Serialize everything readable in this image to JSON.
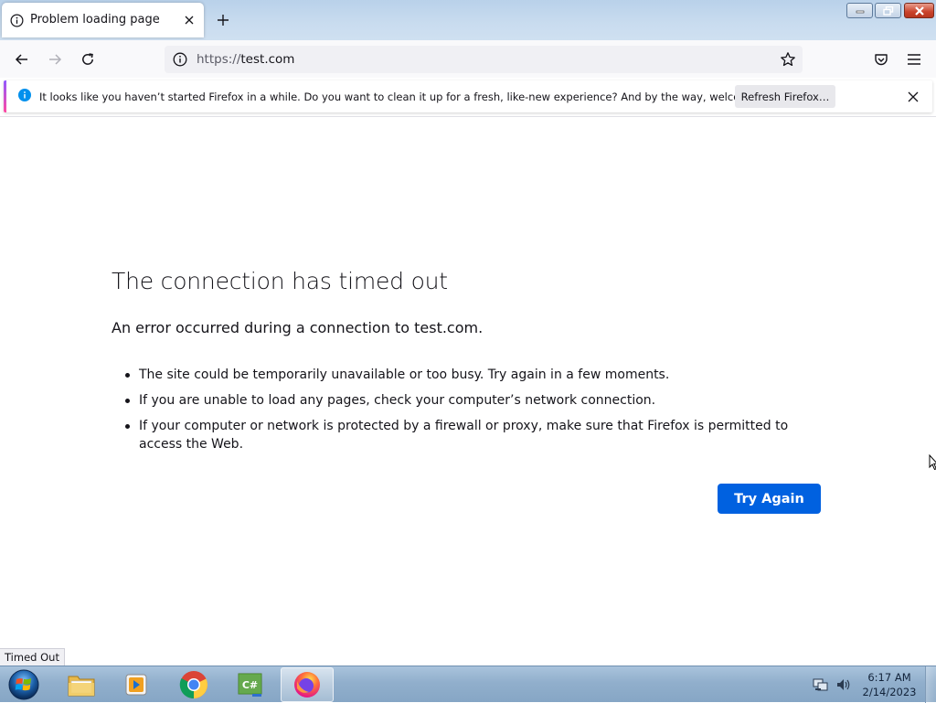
{
  "tab": {
    "title": "Problem loading page"
  },
  "urlbar": {
    "scheme": "https://",
    "host": "test.com"
  },
  "notification": {
    "message": "It looks like you haven’t started Firefox in a while. Do you want to clean it up for a fresh, like-new experience? And by the way, welcome back!",
    "button": "Refresh Firefox…"
  },
  "error": {
    "title": "The connection has timed out",
    "subtitle": "An error occurred during a connection to test.com.",
    "bullets": [
      "The site could be temporarily unavailable or too busy. Try again in a few moments.",
      "If you are unable to load any pages, check your computer’s network connection.",
      "If your computer or network is protected by a firewall or proxy, make sure that Firefox is permitted to access the Web."
    ],
    "button": "Try Again"
  },
  "status_bar": {
    "text": "Timed Out"
  },
  "taskbar": {
    "items": [
      "folder-icon",
      "media-player-icon",
      "chrome-icon",
      "csharp-icon",
      "firefox-icon"
    ],
    "clock": {
      "time": "6:17 AM",
      "date": "2/14/2023"
    }
  },
  "colors": {
    "accent": "#0061e0",
    "text": "#15141a"
  }
}
